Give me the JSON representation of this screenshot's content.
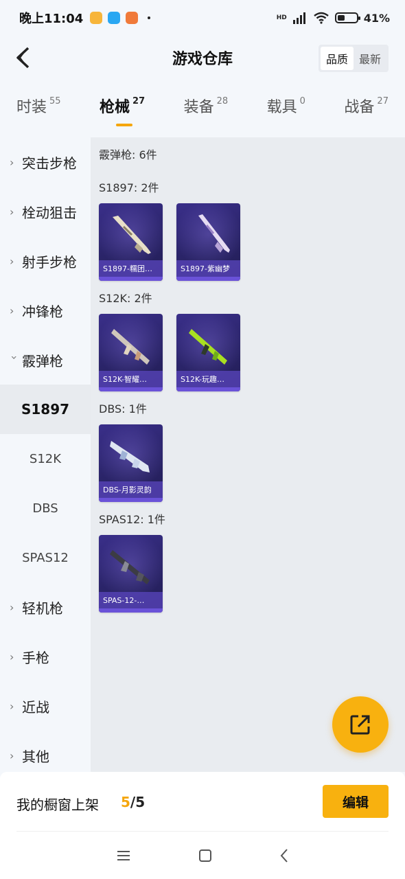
{
  "status": {
    "time": "晚上11:04",
    "network": "HD",
    "battery": "41%",
    "battery_level": 0.41
  },
  "header": {
    "title": "游戏仓库",
    "sort_quality": "品质",
    "sort_latest": "最新"
  },
  "tabs": [
    {
      "label": "时装",
      "count": "55"
    },
    {
      "label": "枪械",
      "count": "27"
    },
    {
      "label": "装备",
      "count": "28"
    },
    {
      "label": "载具",
      "count": "0"
    },
    {
      "label": "战备",
      "count": "27"
    }
  ],
  "sidebar": {
    "categories": [
      {
        "label": "突击步枪"
      },
      {
        "label": "栓动狙击"
      },
      {
        "label": "射手步枪"
      },
      {
        "label": "冲锋枪"
      },
      {
        "label": "霰弹枪"
      },
      {
        "label": "轻机枪"
      },
      {
        "label": "手枪"
      },
      {
        "label": "近战"
      },
      {
        "label": "其他"
      }
    ],
    "subitems": [
      {
        "label": "S1897"
      },
      {
        "label": "S12K"
      },
      {
        "label": "DBS"
      },
      {
        "label": "SPAS12"
      }
    ]
  },
  "content": {
    "total_label": "霰弹枪: 6件",
    "groups": [
      {
        "label": "S1897: 2件",
        "items": [
          {
            "name": "S1897-糯团…",
            "icon": "shotgun-pump-cream-icon"
          },
          {
            "name": "S1897-紫幽梦",
            "icon": "shotgun-pump-purple-icon"
          }
        ]
      },
      {
        "label": "S12K: 2件",
        "items": [
          {
            "name": "S12K-智耀…",
            "icon": "shotgun-auto-tan-icon"
          },
          {
            "name": "S12K-玩趣…",
            "icon": "shotgun-auto-green-icon"
          }
        ]
      },
      {
        "label": "DBS: 1件",
        "items": [
          {
            "name": "DBS-月影灵韵",
            "icon": "shotgun-bullpup-silver-icon"
          }
        ]
      },
      {
        "label": "SPAS12: 1件",
        "items": [
          {
            "name": "SPAS-12-…",
            "icon": "shotgun-spas-dark-icon"
          }
        ]
      }
    ]
  },
  "bottom": {
    "shelf_label": "我的橱窗上架",
    "shelf_current": "5",
    "shelf_total": "/5",
    "edit_label": "编辑"
  },
  "colors": {
    "accent": "#f8b10f",
    "card_bg": "#2a2468",
    "card_label": "#5a46be"
  }
}
